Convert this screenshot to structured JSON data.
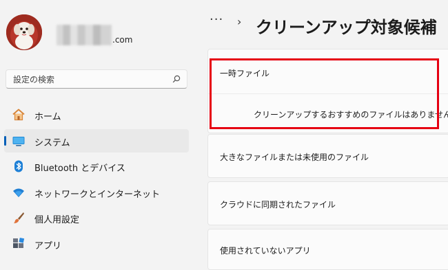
{
  "account": {
    "email_domain": ".com"
  },
  "search": {
    "placeholder": "設定の検索"
  },
  "nav": {
    "items": [
      {
        "label": "ホーム",
        "icon": "home-icon"
      },
      {
        "label": "システム",
        "icon": "system-icon",
        "selected": true
      },
      {
        "label": "Bluetooth とデバイス",
        "icon": "bluetooth-icon"
      },
      {
        "label": "ネットワークとインターネット",
        "icon": "wifi-icon"
      },
      {
        "label": "個人用設定",
        "icon": "brush-icon"
      },
      {
        "label": "アプリ",
        "icon": "apps-icon"
      }
    ]
  },
  "breadcrumb": {
    "more": "···",
    "separator": "›",
    "title": "クリーンアップ対象候補"
  },
  "cards": {
    "temp": {
      "title": "一時ファイル",
      "message": "クリーンアップするおすすめのファイルはありません。"
    },
    "large": {
      "title": "大きなファイルまたは未使用のファイル"
    },
    "cloud": {
      "title": "クラウドに同期されたファイル"
    },
    "unused": {
      "title": "使用されていないアプリ"
    }
  },
  "colors": {
    "accent": "#005fb8",
    "highlight": "#e60012"
  }
}
